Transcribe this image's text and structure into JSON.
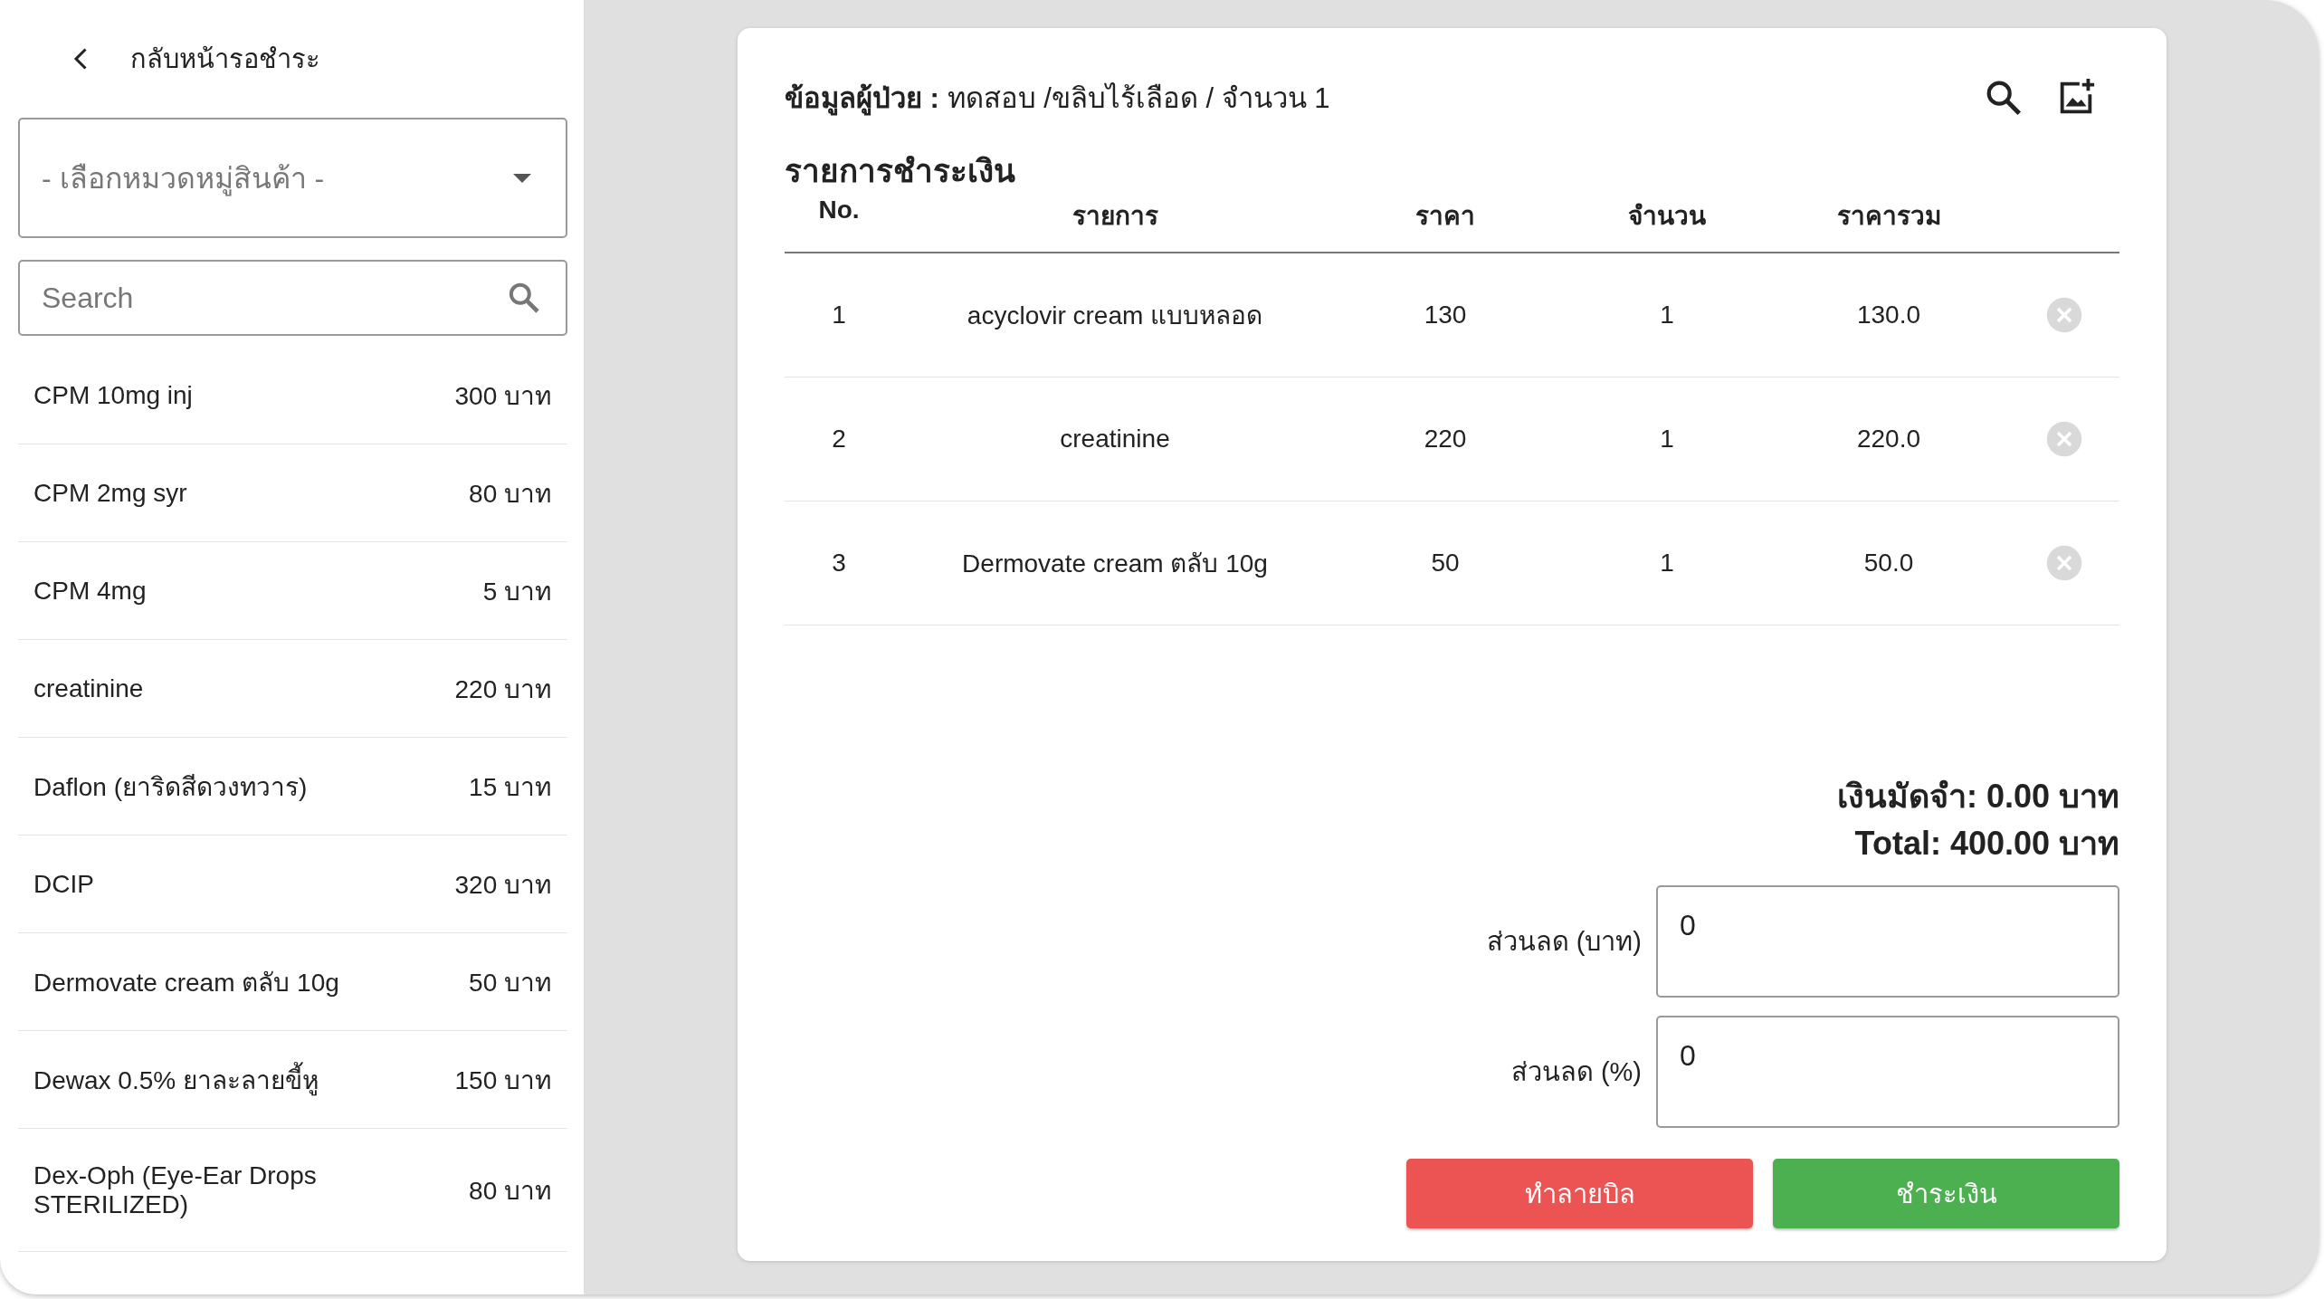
{
  "sidebar": {
    "back_label": "กลับหน้ารอชำระ",
    "category_select": {
      "placeholder": "- เลือกหมวดหมู่สินค้า -"
    },
    "search": {
      "placeholder": "Search"
    },
    "products": [
      {
        "name": "CPM 10mg inj",
        "price": "300 บาท"
      },
      {
        "name": "CPM 2mg syr",
        "price": "80 บาท"
      },
      {
        "name": "CPM 4mg",
        "price": "5 บาท"
      },
      {
        "name": "creatinine",
        "price": "220 บาท"
      },
      {
        "name": "Daflon (ยาริดสีดวงทวาร)",
        "price": "15 บาท"
      },
      {
        "name": "DCIP",
        "price": "320 บาท"
      },
      {
        "name": "Dermovate cream ตลับ 10g",
        "price": "50 บาท"
      },
      {
        "name": "Dewax 0.5% ยาละลายขี้หู",
        "price": "150 บาท"
      },
      {
        "name": "Dex-Oph (Eye-Ear Drops STERILIZED)",
        "price": "80 บาท"
      }
    ]
  },
  "patient_info": "**ข้อมูลผู้ป่วย :** ทดสอบ /ขลิบไร้เลือด / จำนวน 1",
  "section_title": "รายการชำระเงิน",
  "table": {
    "columns": [
      "No.",
      "รายการ",
      "ราคา",
      "จำนวน",
      "ราคารวม"
    ],
    "rows": [
      [
        "1",
        "acyclovir cream แบบหลอด",
        "130",
        "1",
        "130.0"
      ],
      [
        "2",
        "creatinine",
        "220",
        "1",
        "220.0"
      ],
      [
        "3",
        "Dermovate cream ตลับ 10g",
        "50",
        "1",
        "50.0"
      ]
    ]
  },
  "deposit": "เงินมัดจำ: 0.00 บาท",
  "total": "Total: 400.00 บาท",
  "discount_fields": [
    {
      "label": "ส่วนลด (บาท)",
      "value": "0"
    },
    {
      "label": "ส่วนลด (%)",
      "value": "0"
    }
  ],
  "buttons": [
    {
      "label": "ทำลายบิล",
      "kind": "danger"
    },
    {
      "label": "ชำระเงิน",
      "kind": "primary"
    }
  ]
}
